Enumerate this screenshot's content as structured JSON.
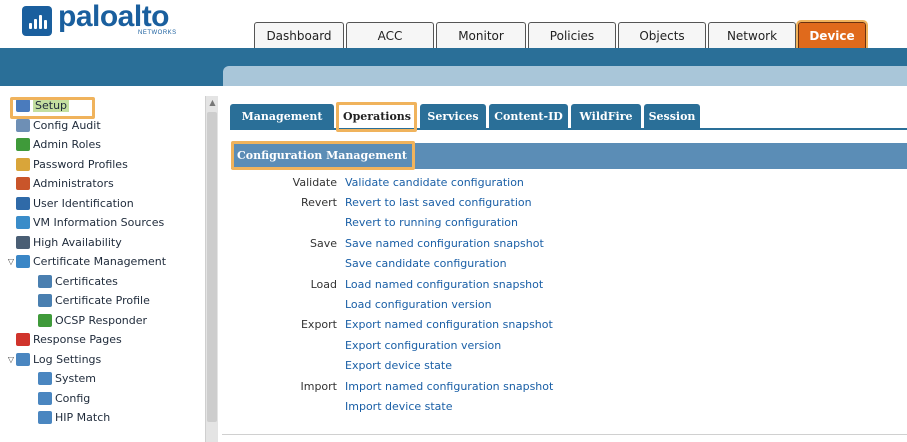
{
  "brand": {
    "name": "paloalto",
    "subtitle": "NETWORKS"
  },
  "main_tabs": [
    {
      "label": "Dashboard",
      "active": false
    },
    {
      "label": "ACC",
      "active": false
    },
    {
      "label": "Monitor",
      "active": false
    },
    {
      "label": "Policies",
      "active": false
    },
    {
      "label": "Objects",
      "active": false
    },
    {
      "label": "Network",
      "active": false
    },
    {
      "label": "Device",
      "active": true
    }
  ],
  "sidebar": {
    "items": [
      {
        "label": "Setup",
        "icon": "setup-icon",
        "icon_color": "#4a7bbd",
        "indent": 0,
        "selected": true,
        "expander": ""
      },
      {
        "label": "Config Audit",
        "icon": "config-audit-icon",
        "icon_color": "#6e8fb5",
        "indent": 0,
        "selected": false,
        "expander": ""
      },
      {
        "label": "Admin Roles",
        "icon": "admin-roles-icon",
        "icon_color": "#3f9a3a",
        "indent": 0,
        "selected": false,
        "expander": ""
      },
      {
        "label": "Password Profiles",
        "icon": "password-profiles-icon",
        "icon_color": "#d9a53a",
        "indent": 0,
        "selected": false,
        "expander": ""
      },
      {
        "label": "Administrators",
        "icon": "administrators-icon",
        "icon_color": "#c9552a",
        "indent": 0,
        "selected": false,
        "expander": ""
      },
      {
        "label": "User Identification",
        "icon": "user-identification-icon",
        "icon_color": "#2f6aa8",
        "indent": 0,
        "selected": false,
        "expander": ""
      },
      {
        "label": "VM Information Sources",
        "icon": "vm-information-sources-icon",
        "icon_color": "#3a8cc9",
        "indent": 0,
        "selected": false,
        "expander": ""
      },
      {
        "label": "High Availability",
        "icon": "high-availability-icon",
        "icon_color": "#4a5e74",
        "indent": 0,
        "selected": false,
        "expander": ""
      },
      {
        "label": "Certificate Management",
        "icon": "certificate-management-icon",
        "icon_color": "#3a86c6",
        "indent": 0,
        "selected": false,
        "expander": "▽"
      },
      {
        "label": "Certificates",
        "icon": "certificates-icon",
        "icon_color": "#4a7fb0",
        "indent": 1,
        "selected": false,
        "expander": ""
      },
      {
        "label": "Certificate Profile",
        "icon": "certificate-profile-icon",
        "icon_color": "#4a7fb0",
        "indent": 1,
        "selected": false,
        "expander": ""
      },
      {
        "label": "OCSP Responder",
        "icon": "ocsp-responder-icon",
        "icon_color": "#3f9a3a",
        "indent": 1,
        "selected": false,
        "expander": ""
      },
      {
        "label": "Response Pages",
        "icon": "response-pages-icon",
        "icon_color": "#d0342c",
        "indent": 0,
        "selected": false,
        "expander": ""
      },
      {
        "label": "Log Settings",
        "icon": "log-settings-icon",
        "icon_color": "#4a86c0",
        "indent": 0,
        "selected": false,
        "expander": "▽"
      },
      {
        "label": "System",
        "icon": "system-icon",
        "icon_color": "#4a86c0",
        "indent": 1,
        "selected": false,
        "expander": ""
      },
      {
        "label": "Config",
        "icon": "config-icon",
        "icon_color": "#4a86c0",
        "indent": 1,
        "selected": false,
        "expander": ""
      },
      {
        "label": "HIP Match",
        "icon": "hip-match-icon",
        "icon_color": "#4a86c0",
        "indent": 1,
        "selected": false,
        "expander": ""
      }
    ]
  },
  "sub_tabs": [
    {
      "label": "Management",
      "active": false
    },
    {
      "label": "Operations",
      "active": true
    },
    {
      "label": "Services",
      "active": false
    },
    {
      "label": "Content-ID",
      "active": false
    },
    {
      "label": "WildFire",
      "active": false
    },
    {
      "label": "Session",
      "active": false
    }
  ],
  "section": {
    "title": "Configuration Management"
  },
  "config_rows": [
    {
      "label": "Validate",
      "link": "Validate candidate configuration"
    },
    {
      "label": "Revert",
      "link": "Revert to last saved configuration"
    },
    {
      "label": "",
      "link": "Revert to running configuration"
    },
    {
      "label": "Save",
      "link": "Save named configuration snapshot"
    },
    {
      "label": "",
      "link": "Save candidate configuration"
    },
    {
      "label": "Load",
      "link": "Load named configuration snapshot"
    },
    {
      "label": "",
      "link": "Load configuration version"
    },
    {
      "label": "Export",
      "link": "Export named configuration snapshot"
    },
    {
      "label": "",
      "link": "Export configuration version"
    },
    {
      "label": "",
      "link": "Export device state"
    },
    {
      "label": "Import",
      "link": "Import named configuration snapshot"
    },
    {
      "label": "",
      "link": "Import device state"
    }
  ],
  "colors": {
    "accent_orange": "#e06a1c",
    "nav_blue": "#2a6f98",
    "section_blue": "#5b8db6",
    "link_blue": "#1a5fa6",
    "highlight": "#f0b35c",
    "selected_green": "#c4dfa0"
  }
}
